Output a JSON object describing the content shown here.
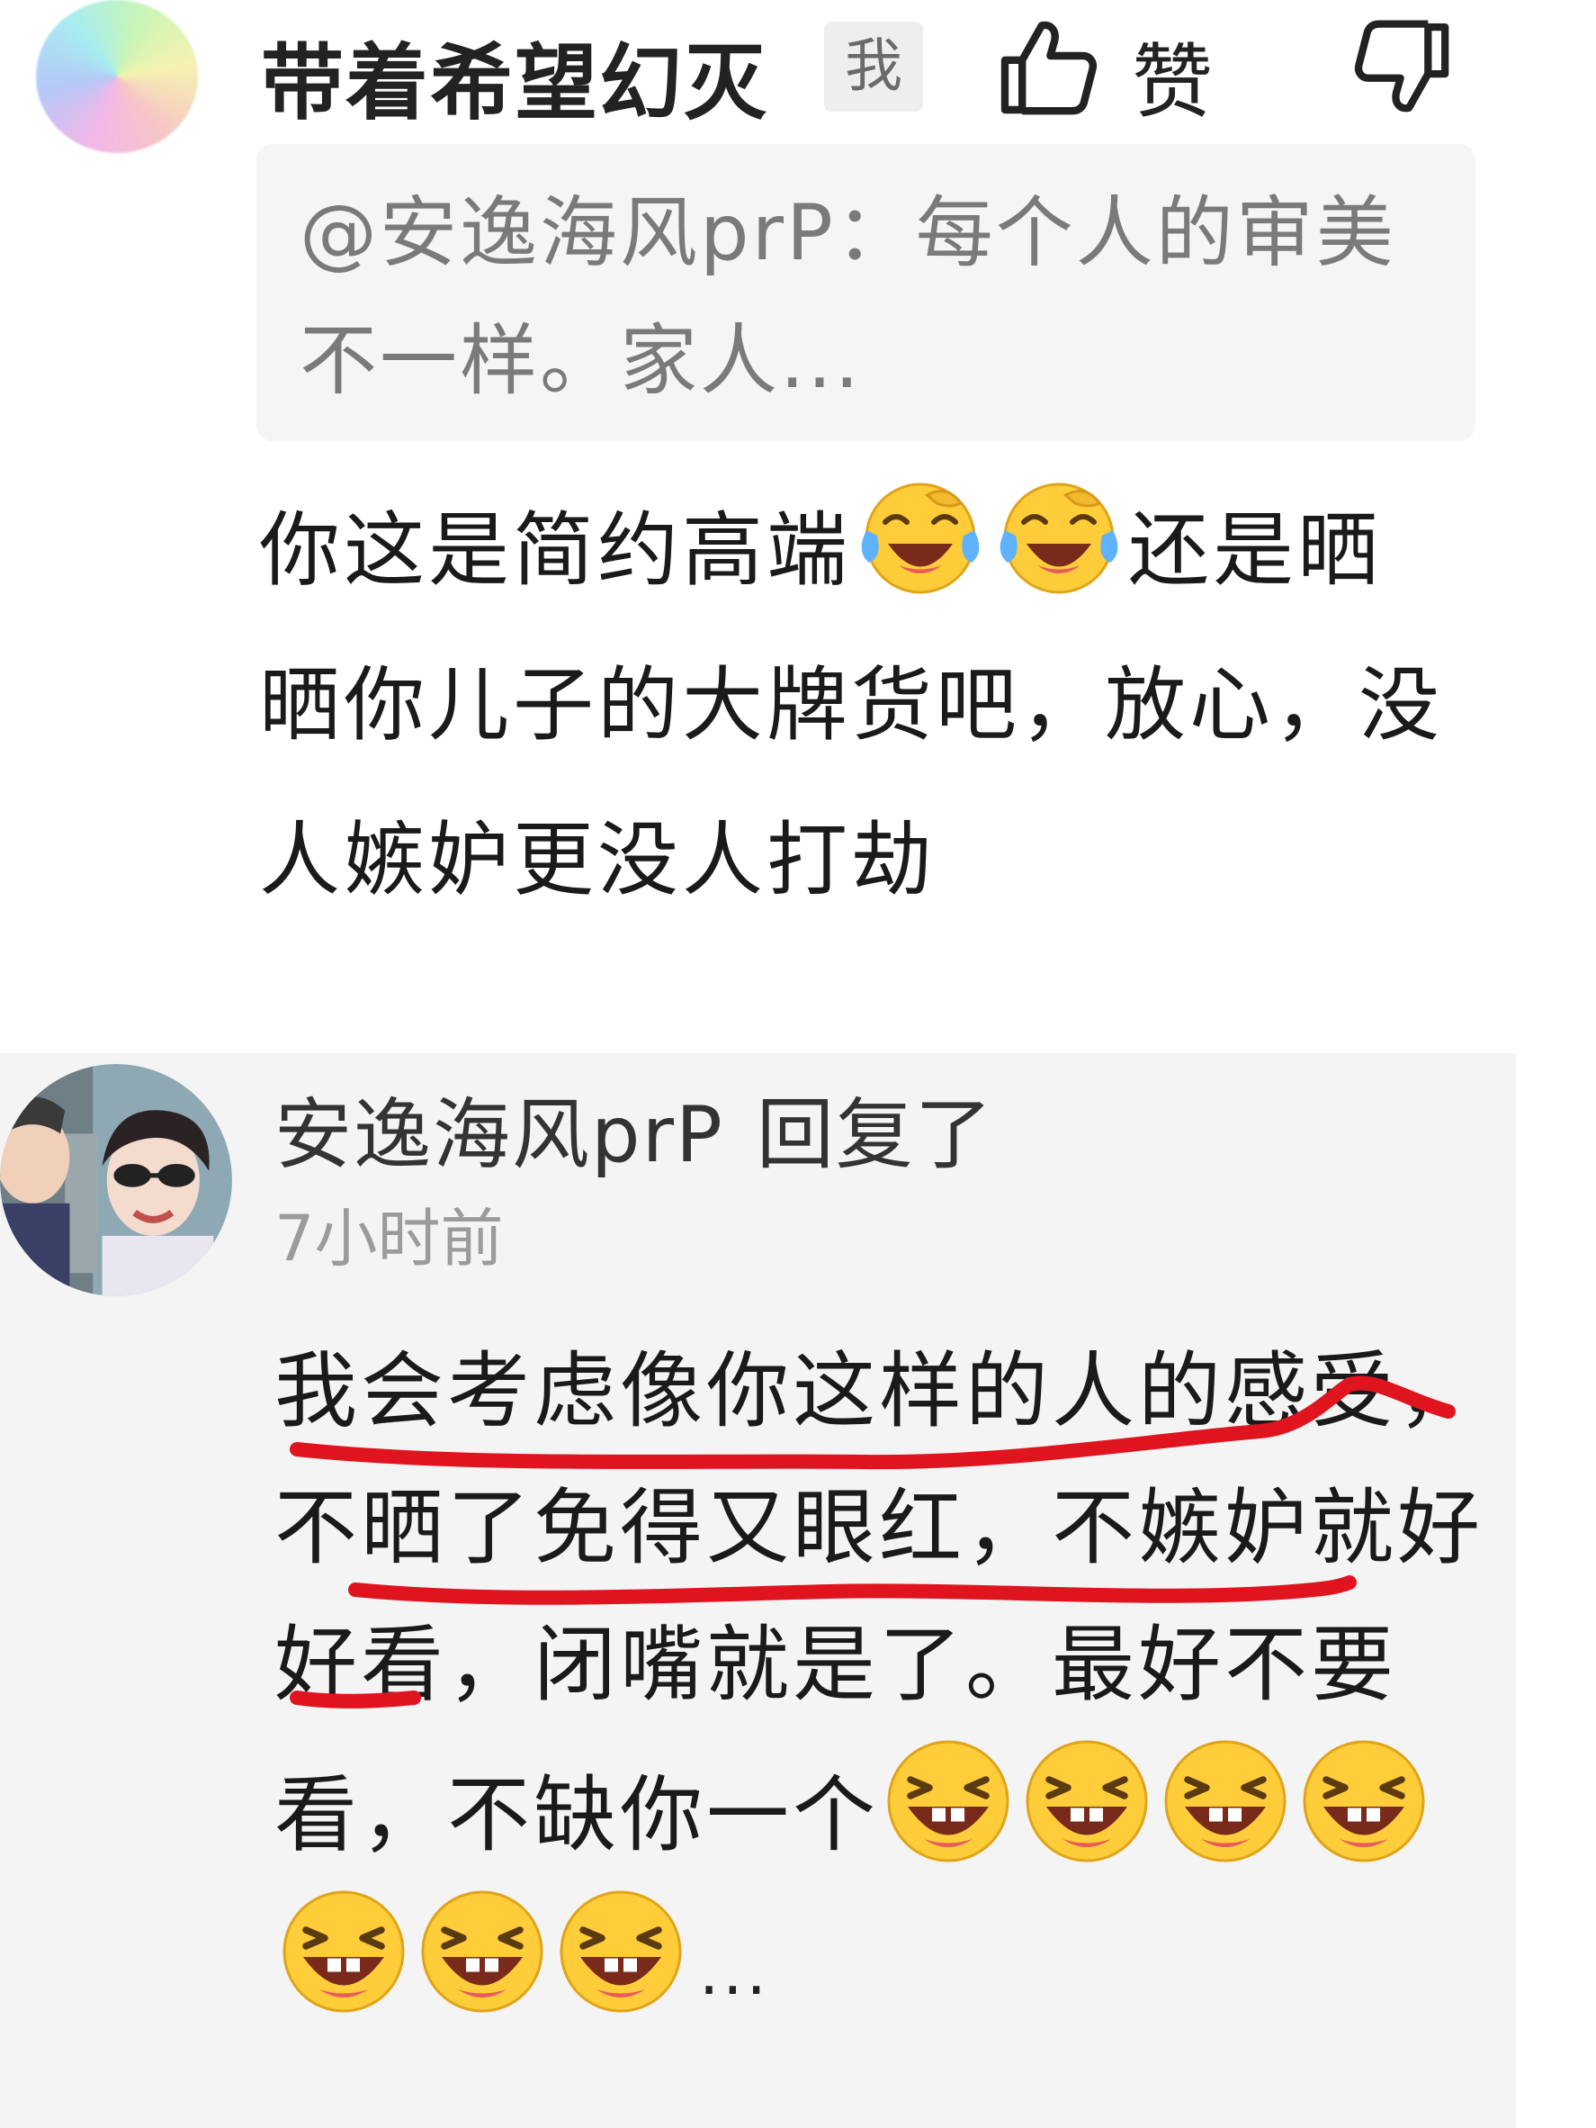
{
  "comment": {
    "username": "带着希望幻灭",
    "me_badge": "我",
    "like_label": "赞",
    "quote": "@安逸海风prP：每个人的审美不一样。家人...",
    "text_part1": "你这是简约高端",
    "text_part2": "还是晒晒你儿子的大牌货吧，放心，没人嫉妒更没人打劫"
  },
  "reply": {
    "username": "安逸海风prP",
    "action": "回复了",
    "time": "7小时前",
    "text": "我会考虑像你这样的人的感受，不晒了免得又眼红，不嫉妒就好好看，闭嘴就是了。最好不要看，不缺你一个",
    "ellipsis": "..."
  },
  "icons": {
    "like": "thumbs-up-icon",
    "dislike": "thumbs-down-icon",
    "cry_laugh_emoji": "crying-laughing-emoji",
    "laugh_emoji": "laughing-emoji"
  },
  "colors": {
    "annotation_red": "#e0141e",
    "reply_background": "#f4f4f4",
    "quote_background": "#f5f5f5"
  }
}
